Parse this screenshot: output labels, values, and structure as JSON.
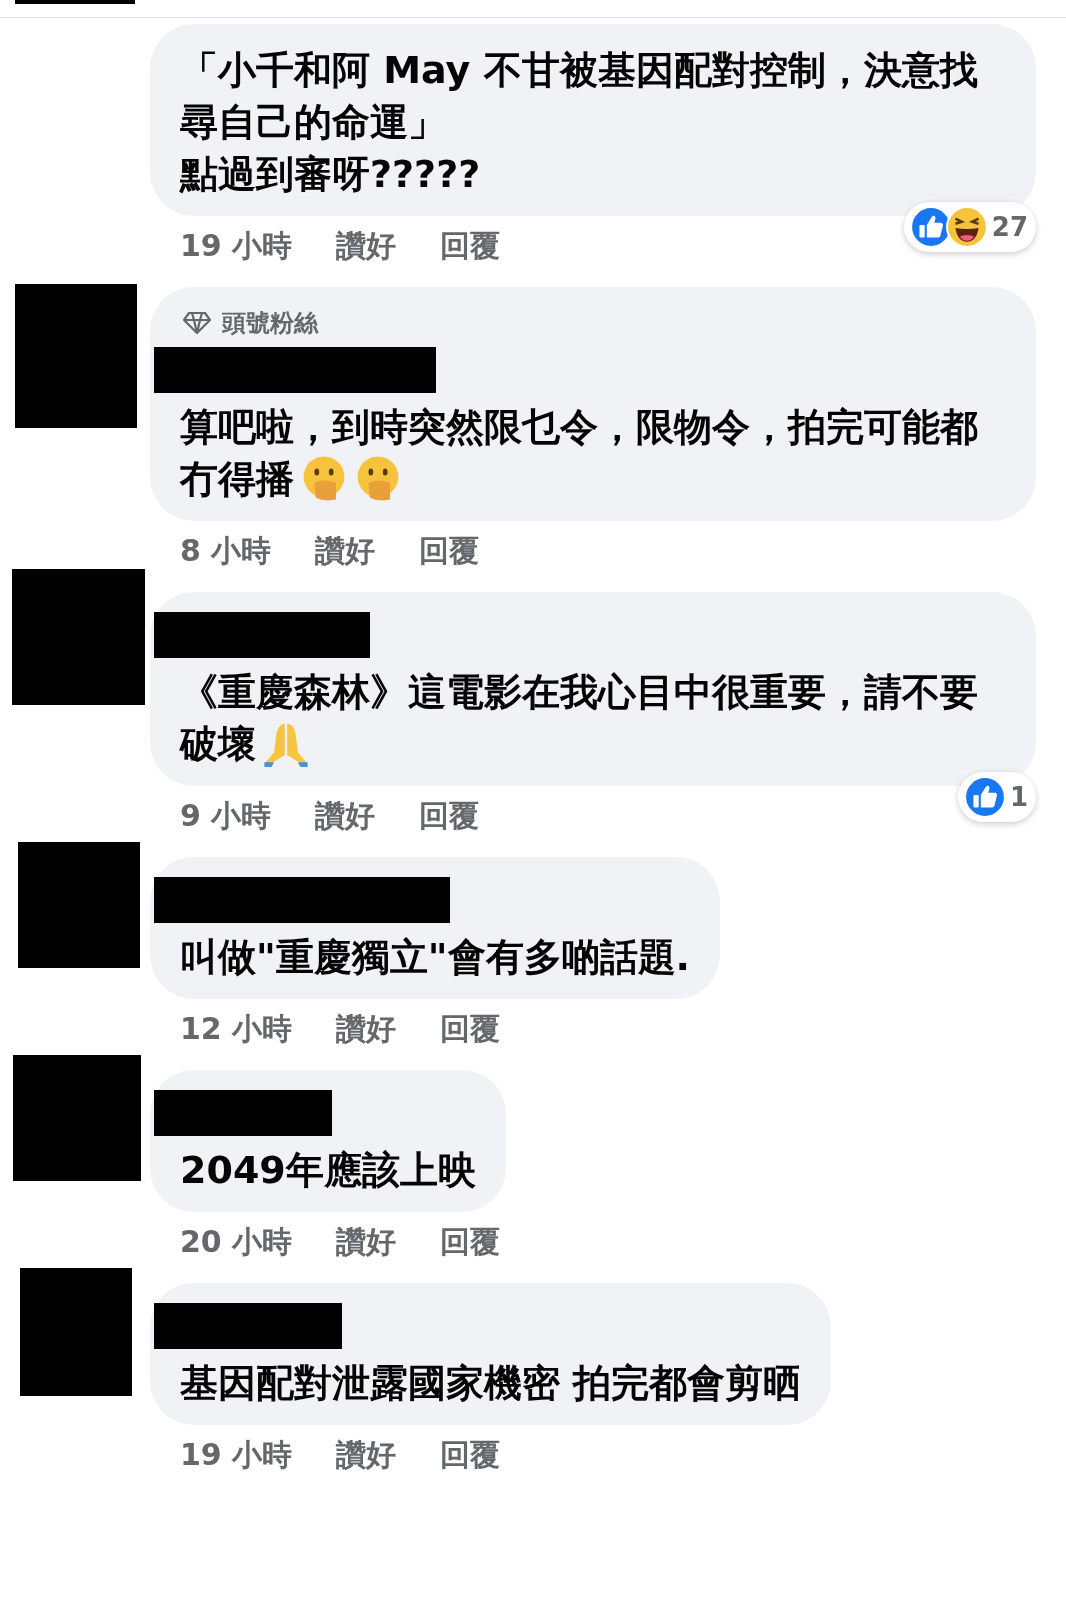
{
  "comments": [
    {
      "avatar_redacted": true,
      "lines": [
        "「小千和阿 May 不甘被基因配對控制，決意找尋自己的命運」",
        "點過到審呀?????"
      ],
      "time": "19 小時",
      "like": "讚好",
      "reply": "回覆",
      "reactions": {
        "icons": [
          {
            "kind": "like"
          },
          {
            "kind": "haha"
          }
        ],
        "count": "27"
      }
    },
    {
      "avatar_redacted": true,
      "badge": "頭號粉絲",
      "name_redacted": true,
      "lines": [
        "算吧啦，到時突然限乜令，限物令，拍完可能都冇得播"
      ],
      "emoji": [
        {
          "kind": "hand_over_mouth"
        },
        {
          "kind": "hand_over_mouth"
        }
      ],
      "time": "8 小時",
      "like": "讚好",
      "reply": "回覆"
    },
    {
      "avatar_redacted": true,
      "name_redacted": true,
      "lines": [
        "《重慶森林》這電影在我心目中很重要，請不要破壞"
      ],
      "emoji": [
        {
          "kind": "praying_hands"
        }
      ],
      "time": "9 小時",
      "like": "讚好",
      "reply": "回覆",
      "reactions": {
        "icons": [
          {
            "kind": "like"
          }
        ],
        "count": "1"
      }
    },
    {
      "avatar_redacted": true,
      "name_redacted": true,
      "lines": [
        "叫做\"重慶獨立\"會有多啲話題."
      ],
      "time": "12 小時",
      "like": "讚好",
      "reply": "回覆"
    },
    {
      "avatar_redacted": true,
      "name_redacted": true,
      "lines": [
        "2049年應該上映"
      ],
      "time": "20 小時",
      "like": "讚好",
      "reply": "回覆"
    },
    {
      "avatar_redacted": true,
      "name_redacted": true,
      "lines": [
        "基因配對泄露國家機密 拍完都會剪晒"
      ],
      "time": "19 小時",
      "like": "讚好",
      "reply": "回覆"
    }
  ]
}
